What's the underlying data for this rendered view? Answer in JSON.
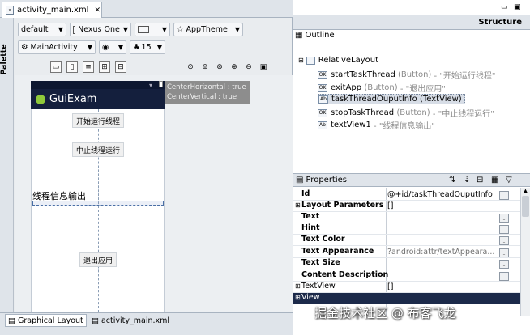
{
  "editor_tab": {
    "label": "activity_main.xml",
    "close": "✕"
  },
  "palette_label": "Palette",
  "toolbar1": {
    "theme_config": "default",
    "device": "Nexus One",
    "app_theme": "AppTheme"
  },
  "toolbar2": {
    "activity": "MainActivity",
    "api_level": "15"
  },
  "phone": {
    "app_title": "GuiExam",
    "hint_line1": "CenterHorizontal : true",
    "hint_line2": "CenterVertical : true",
    "button_start": "开始运行线程",
    "button_stop": "中止线程运行",
    "textview_info": "线程信息输出",
    "button_exit": "退出应用"
  },
  "structure": {
    "title": "Structure"
  },
  "outline": {
    "title": "Outline",
    "root": "RelativeLayout",
    "items": [
      {
        "name": "startTaskThread",
        "type": "(Button)",
        "text": "- \"开始运行线程\""
      },
      {
        "name": "exitApp",
        "type": "(Button)",
        "text": "- \"退出应用\""
      },
      {
        "name": "taskThreadOuputInfo",
        "type": "(TextView)",
        "text": ""
      },
      {
        "name": "stopTaskThread",
        "type": "(Button)",
        "text": "- \"中止线程运行\""
      },
      {
        "name": "textView1",
        "type": "",
        "text": "- \"线程信息输出\""
      }
    ]
  },
  "properties": {
    "title": "Properties",
    "rows": [
      {
        "label": "Id",
        "value": "@+id/taskThreadOuputInfo"
      },
      {
        "label": "Layout Parameters",
        "value": "[]"
      },
      {
        "label": "Text",
        "value": ""
      },
      {
        "label": "Hint",
        "value": ""
      },
      {
        "label": "Text Color",
        "value": ""
      },
      {
        "label": "Text Appearance",
        "value": "?android:attr/textAppeara..."
      },
      {
        "label": "Text Size",
        "value": ""
      },
      {
        "label": "Content Description",
        "value": ""
      },
      {
        "label": "TextView",
        "value": "[]"
      },
      {
        "label": "View",
        "value": ""
      }
    ]
  },
  "bottom_tabs": {
    "graphical": "Graphical Layout",
    "xml": "activity_main.xml"
  },
  "watermark": "掘金技术社区 @ 布客飞龙"
}
